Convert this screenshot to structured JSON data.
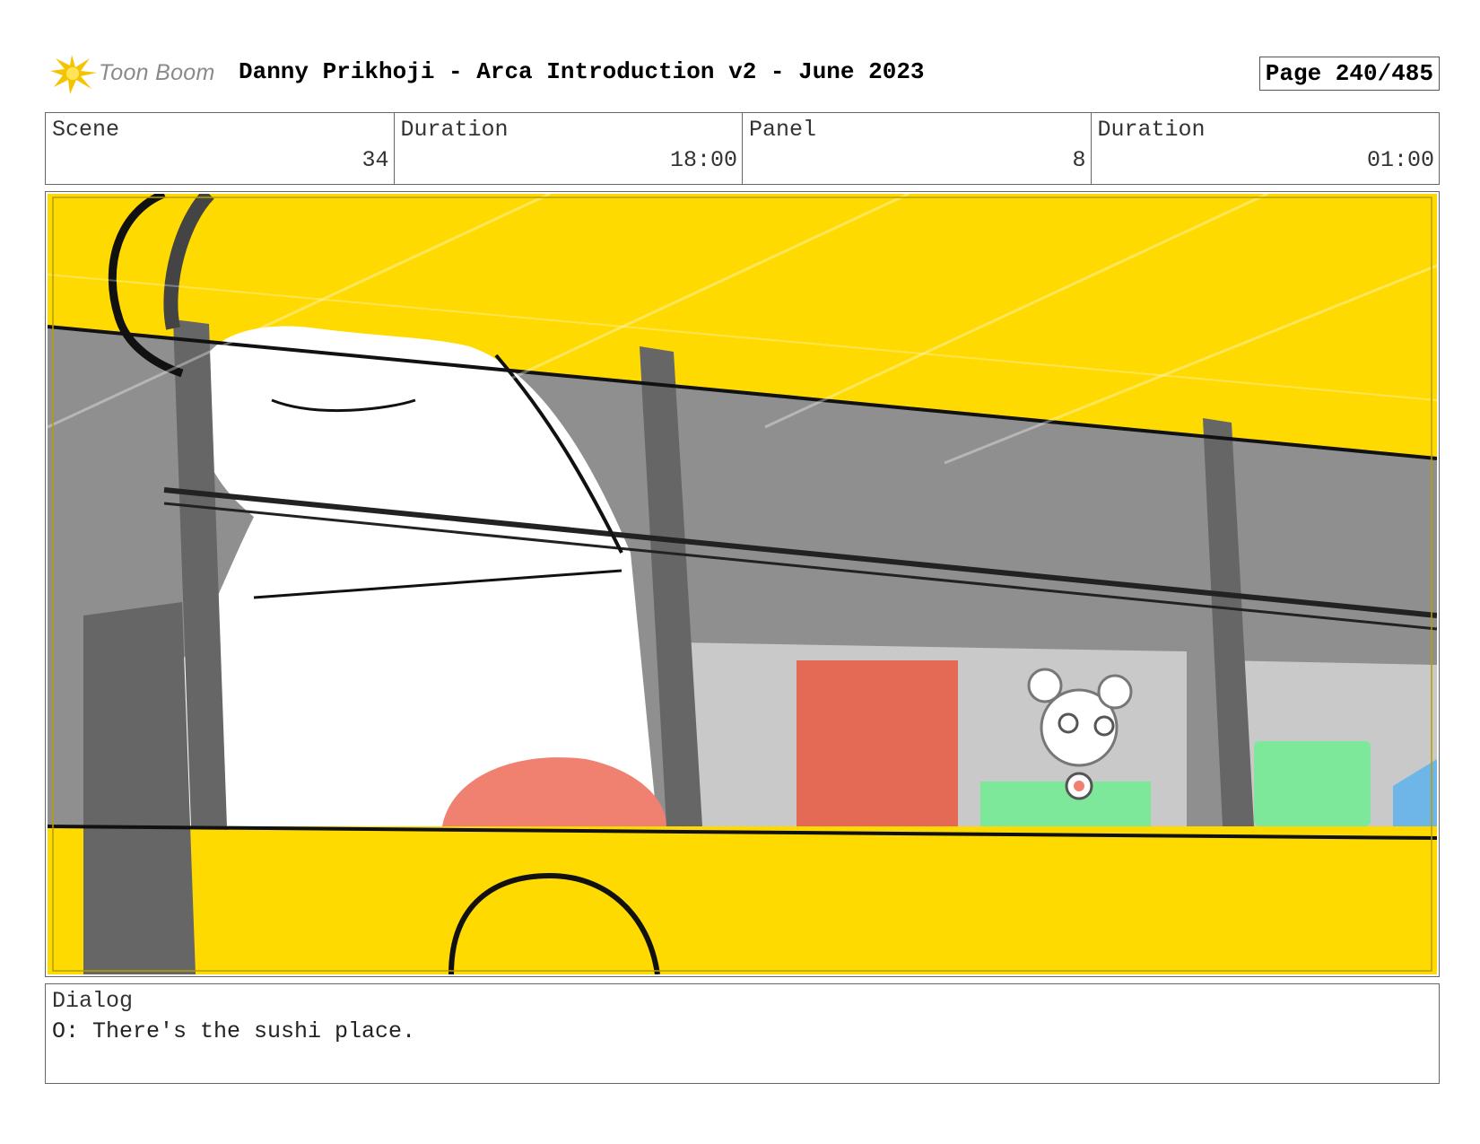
{
  "header": {
    "logo_text": "Toon Boom",
    "title": "Danny Prikhoji - Arca Introduction v2 - June 2023",
    "page": "Page 240/485"
  },
  "info": {
    "scene_label": "Scene",
    "scene_value": "34",
    "scene_duration_label": "Duration",
    "scene_duration_value": "18:00",
    "panel_label": "Panel",
    "panel_value": "8",
    "panel_duration_label": "Duration",
    "panel_duration_value": "01:00"
  },
  "dialog": {
    "label": "Dialog",
    "text": "O: There's the sushi place."
  },
  "colors": {
    "bus_yellow": "#FFDA00",
    "window_gray": "#8f8f8f",
    "sushi_red": "#f08070",
    "sign_green": "#7de89a",
    "sign_blue": "#6fb6e8",
    "logo_flare": "#f5c400"
  }
}
